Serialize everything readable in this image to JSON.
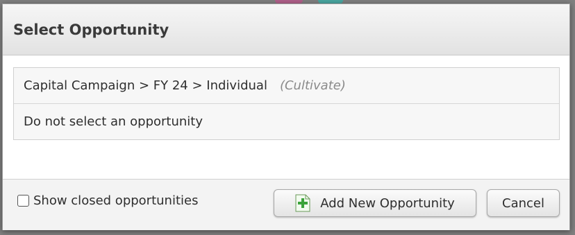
{
  "dialog": {
    "title": "Select Opportunity"
  },
  "opportunities": [
    {
      "label": "Capital Campaign > FY 24 > Individual",
      "stage": "(Cultivate)"
    },
    {
      "label": "Do not select an opportunity",
      "stage": ""
    }
  ],
  "footer": {
    "show_closed_label": "Show closed opportunities",
    "show_closed_checked": false,
    "add_button_label": "Add New Opportunity",
    "add_button_icon": "add-document-icon",
    "cancel_button_label": "Cancel"
  },
  "colors": {
    "icon_green": "#3aa33a",
    "title_text": "#3a3a3a",
    "stage_text": "#8a8a8a"
  }
}
